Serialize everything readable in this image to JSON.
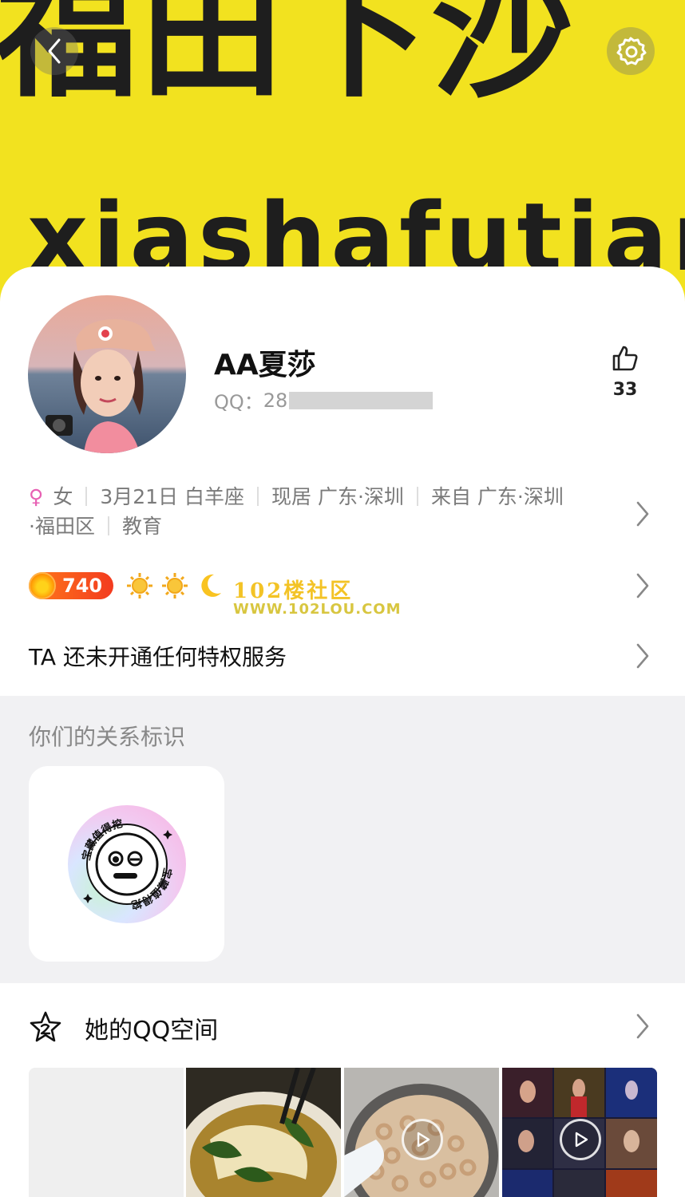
{
  "cover": {
    "big_text": "福田下沙",
    "pinyin_text": "xiashafutian"
  },
  "profile": {
    "nickname": "AA夏莎",
    "qq_label": "QQ：",
    "qq_prefix": "28",
    "likes": "33"
  },
  "info": {
    "gender": "女",
    "birthday": "3月21日",
    "zodiac": "白羊座",
    "residence_label": "现居",
    "residence": "广东·深圳",
    "hometown_label": "来自",
    "hometown": "广东·深圳",
    "district": "·福田区",
    "occupation": "教育"
  },
  "level": {
    "value": "740",
    "icons": [
      "sun-icon",
      "sun-icon",
      "moon-icon"
    ]
  },
  "watermark": {
    "title": "102楼社区",
    "url": "WWW.102LOU.COM"
  },
  "privilege": {
    "text": "TA 还未开通任何特权服务"
  },
  "relation": {
    "title": "你们的关系标识",
    "badge_text": "宝藏值得挖掘"
  },
  "qzone": {
    "title": "她的QQ空间",
    "photos": [
      {
        "type": "blank"
      },
      {
        "type": "image"
      },
      {
        "type": "video"
      },
      {
        "type": "video"
      }
    ]
  },
  "colors": {
    "cover_bg": "#f2e21f",
    "female_pink": "#e760b3",
    "level_orange": "#f33b1f"
  }
}
